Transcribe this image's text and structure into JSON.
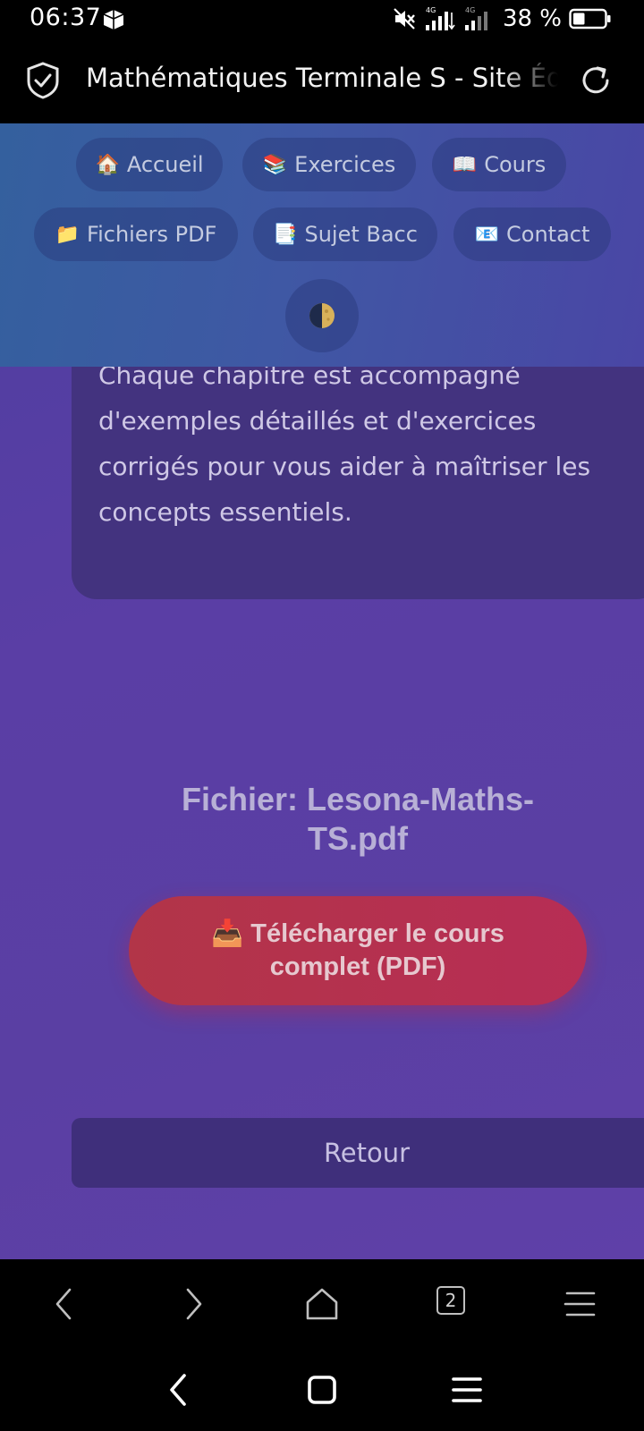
{
  "status_bar": {
    "time": "06:37",
    "network_label_1": "4G",
    "network_label_2": "4G",
    "battery_percent": "38 %",
    "battery_level": 0.38,
    "icons": [
      "app-notification-icon",
      "mute-icon",
      "signal-icon",
      "battery-icon"
    ]
  },
  "browser": {
    "page_title": "Mathématiques Terminale S - Site Éducatif",
    "icons": [
      "shield-check-icon",
      "reload-icon"
    ]
  },
  "nav": {
    "items": [
      {
        "emoji": "🏠",
        "label": "Accueil"
      },
      {
        "emoji": "📚",
        "label": "Exercices"
      },
      {
        "emoji": "📖",
        "label": "Cours"
      },
      {
        "emoji": "📁",
        "label": "Fichiers PDF"
      },
      {
        "emoji": "📑",
        "label": "Sujet Bacc"
      },
      {
        "emoji": "📧",
        "label": "Contact"
      }
    ],
    "theme_toggle_icon": "half-moon-icon"
  },
  "content": {
    "card_text": "Chaque chapitre est accompagné d'exemples détaillés et d'exercices corrigés pour vous aider à maîtriser les concepts essentiels.",
    "file_name": "Fichier: Lesona-Maths-TS.pdf",
    "download_emoji": "📥",
    "download_label": "Télécharger le cours complet (PDF)",
    "back_label": "Retour"
  },
  "toolbar": {
    "tab_count": "2",
    "icons": [
      "back-arrow-icon",
      "forward-arrow-icon",
      "home-icon",
      "tabs-icon",
      "menu-icon"
    ]
  },
  "system_nav": {
    "icons": [
      "system-back-icon",
      "system-home-icon",
      "system-recents-icon"
    ]
  }
}
